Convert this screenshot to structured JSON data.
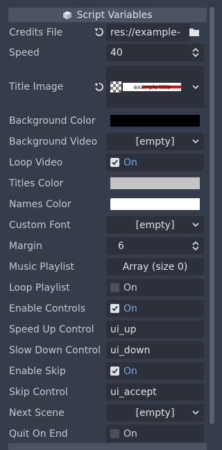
{
  "section_title": "Script Variables",
  "rows": {
    "credits_file": {
      "label": "Credits File",
      "value": "res://example-"
    },
    "speed": {
      "label": "Speed",
      "value": "40"
    },
    "title_image": {
      "label": "Title Image",
      "thumbnail_text": "example title"
    },
    "background_color": {
      "label": "Background Color",
      "color": "#000000"
    },
    "background_video": {
      "label": "Background Video",
      "value": "[empty]"
    },
    "loop_video": {
      "label": "Loop Video",
      "checked": true,
      "text": "On"
    },
    "titles_color": {
      "label": "Titles Color",
      "color": "#c4c4c4"
    },
    "names_color": {
      "label": "Names Color",
      "color": "#ffffff"
    },
    "custom_font": {
      "label": "Custom Font",
      "value": "[empty]"
    },
    "margin": {
      "label": "Margin",
      "value": "6"
    },
    "music_playlist": {
      "label": "Music Playlist",
      "value": "Array (size 0)"
    },
    "loop_playlist": {
      "label": "Loop Playlist",
      "checked": false,
      "text": "On"
    },
    "enable_controls": {
      "label": "Enable Controls",
      "checked": true,
      "text": "On"
    },
    "speed_up_control": {
      "label": "Speed Up Control",
      "value": "ui_up"
    },
    "slow_down_control": {
      "label": "Slow Down Control",
      "value": "ui_down"
    },
    "enable_skip": {
      "label": "Enable Skip",
      "checked": true,
      "text": "On"
    },
    "skip_control": {
      "label": "Skip Control",
      "value": "ui_accept"
    },
    "next_scene": {
      "label": "Next Scene",
      "value": "[empty]"
    },
    "quit_on_end": {
      "label": "Quit On End",
      "checked": false,
      "text": "On"
    }
  },
  "colors": {
    "panel_bg": "#363d4a",
    "editor_bg": "#2c313c",
    "header_bg": "#4b5262",
    "accent_on": "#76a5e6"
  },
  "icons": [
    "cube-icon",
    "reset-icon",
    "folder-icon",
    "chevron-down-icon",
    "spinner-icon",
    "checkbox-icon"
  ]
}
